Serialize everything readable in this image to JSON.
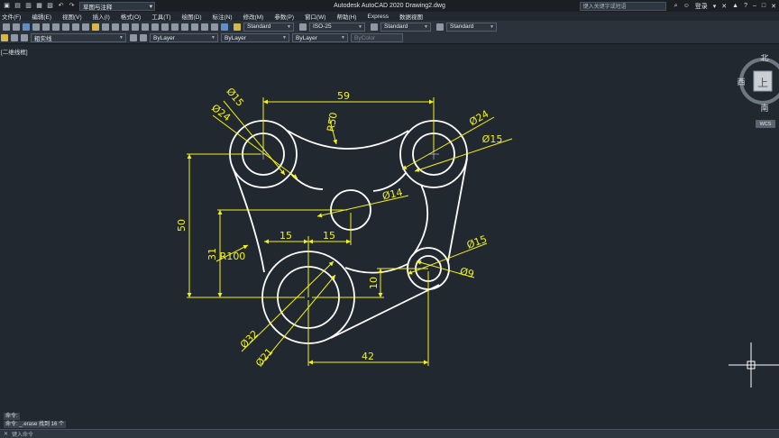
{
  "window": {
    "title": "Autodesk AutoCAD 2020    Drawing2.dwg",
    "workspace": "草图与注释",
    "search_placeholder": "键入关键字或短语",
    "login": "登录"
  },
  "menu": [
    "文件(F)",
    "编辑(E)",
    "视图(V)",
    "插入(I)",
    "格式(O)",
    "工具(T)",
    "绘图(D)",
    "标注(N)",
    "修改(M)",
    "参数(P)",
    "窗口(W)",
    "帮助(H)",
    "Express",
    "数据视图"
  ],
  "toolbar1": {
    "text_style": "Standard",
    "dim_style": "ISO-25",
    "table_style": "Standard",
    "mleader_style": "Standard"
  },
  "toolbar2": {
    "layer": "粗实线",
    "color": "ByLayer",
    "linetype": "ByLayer",
    "lineweight": "ByLayer",
    "plotstyle": "ByColor"
  },
  "viewport_label": "[二维线框]",
  "viewcube": {
    "north": "北",
    "south": "南",
    "west": "西",
    "face": "上",
    "wcs": "WCS"
  },
  "command": {
    "history1": "命令:",
    "history2": "命令: _.erase 找到 16 个",
    "input_placeholder": "键入命令"
  },
  "dimensions": {
    "d59": "59",
    "r50": "R50",
    "dia15_tl": "Ø15",
    "dia24_tl": "Ø24",
    "dia24_tr": "Ø24",
    "dia15_tr": "Ø15",
    "dia14": "Ø14",
    "d50": "50",
    "d31": "31",
    "r100": "R100",
    "d15a": "15",
    "d15b": "15",
    "d10": "10",
    "dia15_br": "Ø15",
    "dia9": "Ø9",
    "dia32": "Ø32",
    "dia21": "Ø21",
    "d42": "42"
  },
  "colors": {
    "background": "#212830",
    "geometry": "#ffffff",
    "dimension": "#f2f21a"
  }
}
